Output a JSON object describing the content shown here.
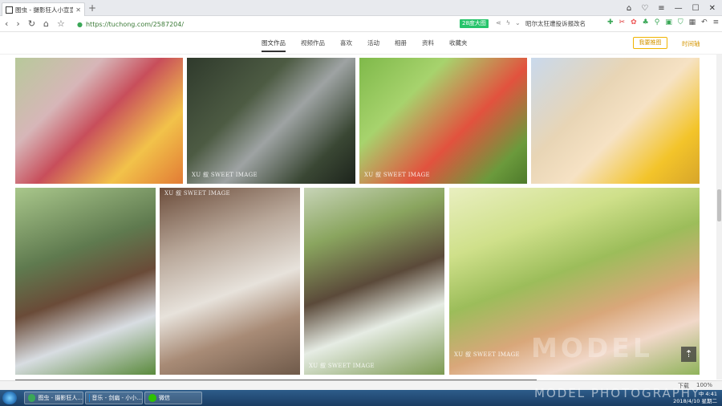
{
  "browser": {
    "tab_title": "图虫 - 摄影狂人小宣宣 - 图虫网",
    "new_tab": "+",
    "url": "https://tuchong.com/2587204/",
    "badge": "28度大图",
    "search_hint": "昭尔太狂遭投诉报改名"
  },
  "site": {
    "tabs": [
      "图文作品",
      "视频作品",
      "喜欢",
      "活动",
      "相册",
      "资料",
      "收藏夹"
    ],
    "active_tab": "图文作品",
    "sponsor_button": "我要推图",
    "timeline_link": "时间轴"
  },
  "photos": [
    {
      "watermark": ""
    },
    {
      "watermark": "XU 叙 SWEET IMAGE"
    },
    {
      "watermark": "XU 叙 SWEET IMAGE"
    },
    {
      "watermark": ""
    },
    {
      "watermark": ""
    },
    {
      "watermark": "XU 叙 SWEET IMAGE"
    },
    {
      "watermark": "XU 叙 SWEET IMAGE"
    },
    {
      "watermark": "XU 叙 SWEET IMAGE"
    }
  ],
  "overlay_watermark": "MODEL",
  "overlay_watermark2": "MODEL PHOTOGRAPHY",
  "statusbar": {
    "download": "下载",
    "zoom": "100%"
  },
  "taskbar": {
    "items": [
      "图虫 - 摄影狂人...",
      "音乐 - 剑扁 - 小小...",
      "微信"
    ],
    "time": "4:41",
    "date": "2018/4/10 星期二",
    "lang": "中"
  },
  "colors": {
    "accent": "#f0b400",
    "url_green": "#3b7a37",
    "badge_green": "#27c46b",
    "taskbar": "#1a3d63"
  }
}
